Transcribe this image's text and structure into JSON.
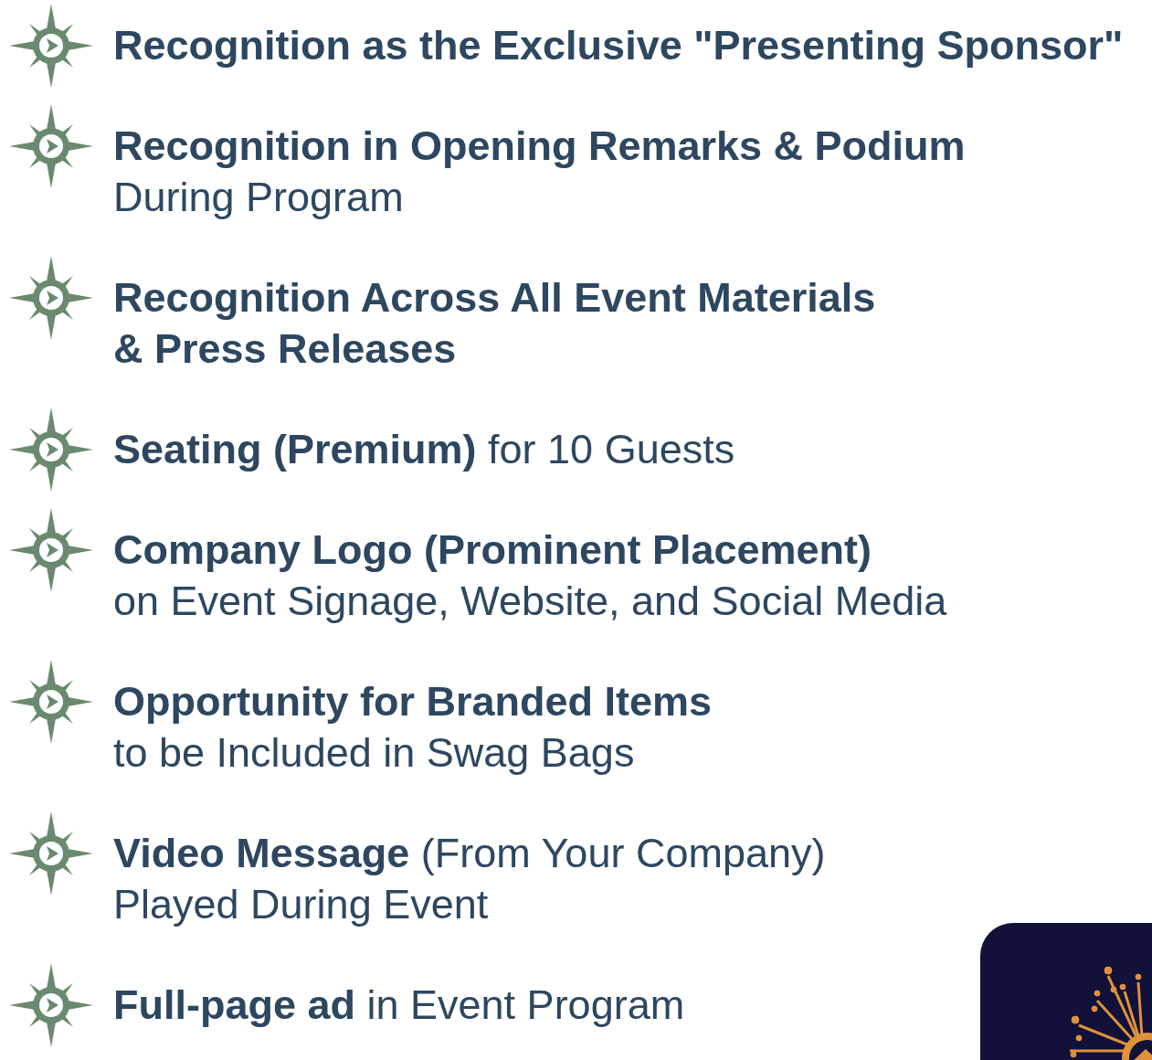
{
  "benefits": [
    {
      "lines": [
        {
          "text": "Recognition as the Exclusive \"Presenting Sponsor\"",
          "bold": true
        }
      ]
    },
    {
      "lines": [
        {
          "text": "Recognition in Opening Remarks & Podium",
          "bold": true
        },
        {
          "text": "During Program",
          "bold": false
        }
      ]
    },
    {
      "lines": [
        {
          "text": "Recognition Across All Event Materials",
          "bold": true
        },
        {
          "text": "& Press Releases",
          "bold": true
        }
      ]
    },
    {
      "lines": [
        {
          "text": "**Seating (Premium)** for 10 Guests",
          "bold": false
        }
      ]
    },
    {
      "lines": [
        {
          "text": "Company Logo (Prominent Placement)",
          "bold": true
        },
        {
          "text": "on Event Signage, Website, and Social Media",
          "bold": false
        }
      ]
    },
    {
      "lines": [
        {
          "text": "Opportunity for Branded Items",
          "bold": true
        },
        {
          "text": "to be Included in Swag Bags",
          "bold": false
        }
      ]
    },
    {
      "lines": [
        {
          "text": "**Video Message** (From Your Company)",
          "bold": false
        },
        {
          "text": "Played During Event",
          "bold": false
        }
      ]
    },
    {
      "lines": [
        {
          "text": "**Full-page ad** in Event Program",
          "bold": false
        }
      ]
    }
  ]
}
